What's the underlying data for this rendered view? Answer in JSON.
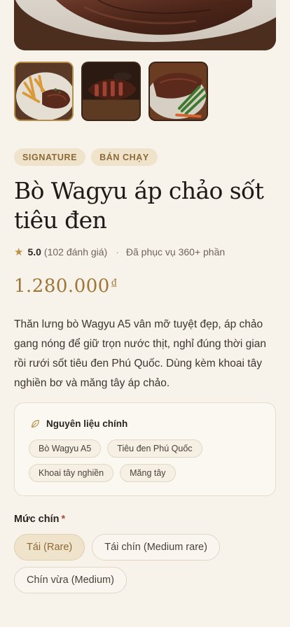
{
  "product": {
    "tags": [
      "SIGNATURE",
      "BÁN CHẠY"
    ],
    "title": "Bò Wagyu áp chảo sốt tiêu đen",
    "rating": "5.0",
    "review_count": "(102 đánh giá)",
    "served": "Đã phục vụ 360+ phần",
    "price": "1.280.000",
    "currency": "₫",
    "description": "Thăn lưng bò Wagyu A5 vân mỡ tuyệt đẹp, áp chảo gang nóng để giữ trọn nước thịt, nghỉ đúng thời gian rồi rưới sốt tiêu đen Phú Quốc. Dùng kèm khoai tây nghiền bơ và măng tây áp chảo."
  },
  "ingredients": {
    "heading": "Nguyên liệu chính",
    "icon": "leaf-icon",
    "items": [
      "Bò Wagyu A5",
      "Tiêu đen Phú Quốc",
      "Khoai tây nghiền",
      "Măng tây"
    ]
  },
  "doneness": {
    "label": "Mức chín",
    "required_mark": "*",
    "options": [
      "Tái (Rare)",
      "Tái chín (Medium rare)",
      "Chín vừa (Medium)"
    ],
    "selected_index": 0
  },
  "colors": {
    "background": "#f7f2ea",
    "accent": "#b9904a",
    "price": "#9c7737",
    "tag_bg": "#efe3cc",
    "required": "#b04a3a"
  }
}
